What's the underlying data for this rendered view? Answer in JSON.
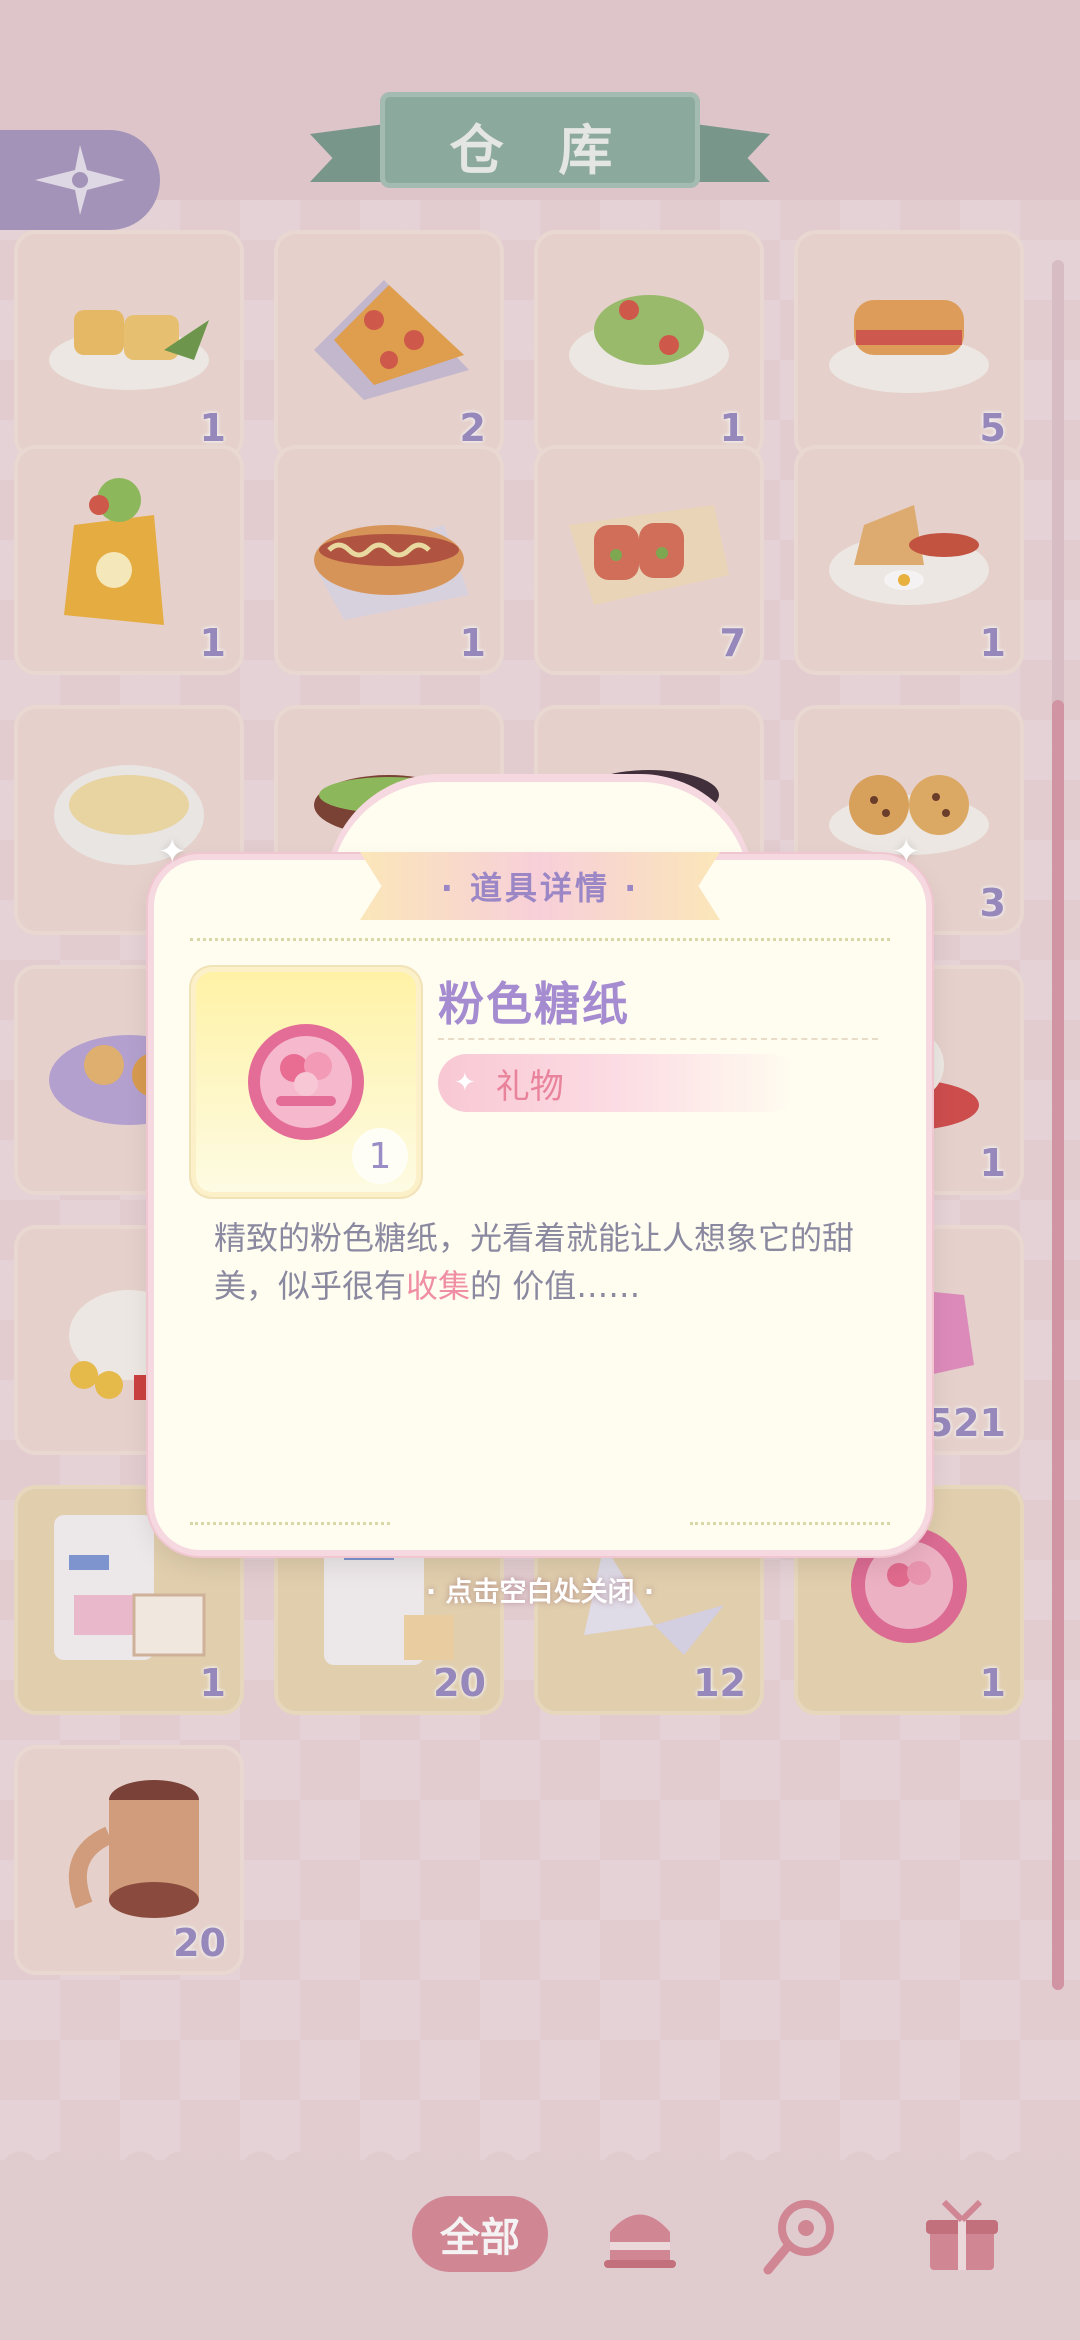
{
  "header": {
    "title": "仓 库",
    "back_icon": "compass-star-icon"
  },
  "grid": {
    "items": [
      {
        "name": "omelette-roll",
        "count": "1"
      },
      {
        "name": "pizza-slice",
        "count": "2"
      },
      {
        "name": "veggie-wrap",
        "count": "1"
      },
      {
        "name": "burger",
        "count": "5"
      },
      {
        "name": "kebab-wrap",
        "count": "1"
      },
      {
        "name": "hot-dog",
        "count": "1"
      },
      {
        "name": "spring-rolls",
        "count": "7"
      },
      {
        "name": "sausage-egg-plate",
        "count": "1"
      },
      {
        "name": "cream-soup",
        "count": ""
      },
      {
        "name": "sandwich",
        "count": ""
      },
      {
        "name": "fried-pot",
        "count": ""
      },
      {
        "name": "cookies",
        "count": "3"
      },
      {
        "name": "feast-platter",
        "count": ""
      },
      {
        "name": "",
        "count": ""
      },
      {
        "name": "",
        "count": ""
      },
      {
        "name": "teapot-set",
        "count": "1"
      },
      {
        "name": "dumpling-set",
        "count": ""
      },
      {
        "name": "",
        "count": ""
      },
      {
        "name": "",
        "count": ""
      },
      {
        "name": "pink-gem",
        "count": "521"
      },
      {
        "name": "sticker-pack",
        "count": "1"
      },
      {
        "name": "sticker-pack-2",
        "count": "20"
      },
      {
        "name": "paper-crane",
        "count": "12"
      },
      {
        "name": "pink-candy-wrapper",
        "count": "1"
      },
      {
        "name": "ribbon-spool",
        "count": "20"
      }
    ]
  },
  "dialog": {
    "header": "· 道具详情 ·",
    "item_name": "粉色糖纸",
    "item_count": "1",
    "item_type": "礼物",
    "desc_part1": "精致的粉色糖纸，光看着就能让人想象它的甜美，似乎很有",
    "desc_highlight": "收集",
    "desc_part2": "的 价值……",
    "close_hint": "· 点击空白处关闭 ·"
  },
  "tabs": {
    "all_label": "全部",
    "icons": [
      "cake-icon",
      "candy-wand-icon",
      "gift-box-icon"
    ]
  },
  "colors": {
    "accent_purple": "#9a8cc4",
    "accent_pink": "#d98a9a",
    "ribbon_teal": "#8fb0a4",
    "highlight": "#ef8ea4"
  }
}
